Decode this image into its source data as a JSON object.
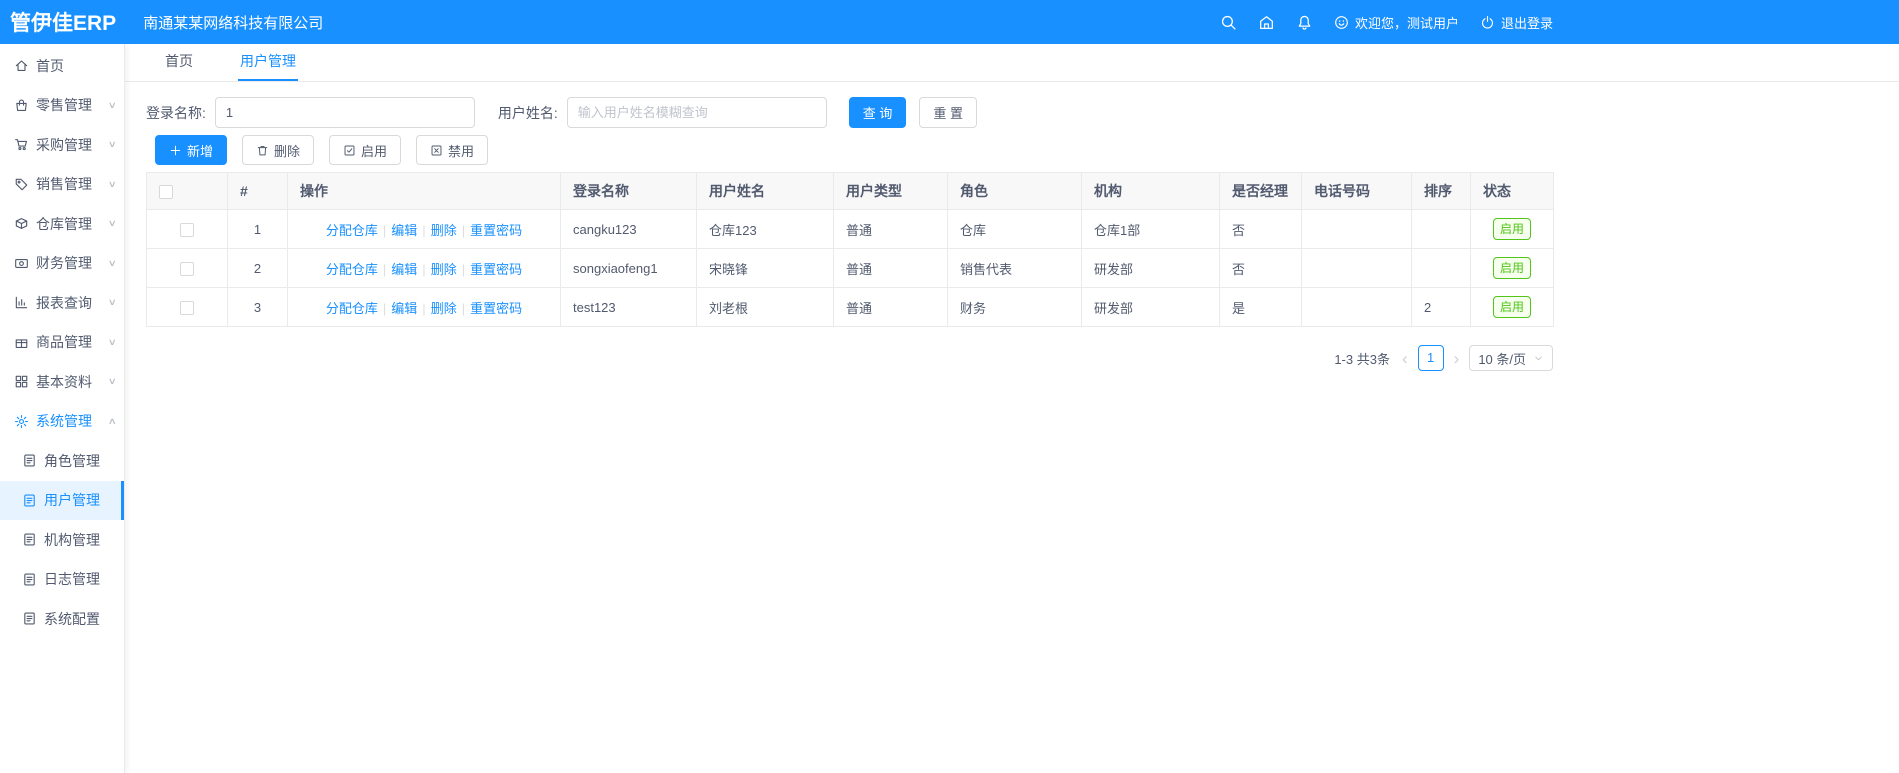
{
  "colors": {
    "primary": "#1890ff",
    "success": "#52c41a",
    "header_bg": "#1890ff",
    "active_menu_bg": "#e7f3fe"
  },
  "header": {
    "logo": "管伊佳ERP",
    "company": "南通某某网络科技有限公司",
    "welcome": "欢迎您，测试用户",
    "logout": "退出登录"
  },
  "icons": {
    "topbar": [
      "search-icon",
      "home-icon",
      "bell-icon",
      "smile-icon",
      "power-icon"
    ],
    "sidebar": [
      "home-icon",
      "retail-icon",
      "purchase-icon",
      "sales-icon",
      "warehouse-icon",
      "finance-icon",
      "report-icon",
      "goods-icon",
      "basic-data-icon",
      "gear-icon",
      "document-icon"
    ]
  },
  "sidebar": {
    "items": [
      {
        "label": "首页",
        "icon": "home-icon",
        "chevron": ""
      },
      {
        "label": "零售管理",
        "icon": "retail-icon",
        "chevron": "∨"
      },
      {
        "label": "采购管理",
        "icon": "purchase-icon",
        "chevron": "∨"
      },
      {
        "label": "销售管理",
        "icon": "sales-icon",
        "chevron": "∨"
      },
      {
        "label": "仓库管理",
        "icon": "warehouse-icon",
        "chevron": "∨"
      },
      {
        "label": "财务管理",
        "icon": "finance-icon",
        "chevron": "∨"
      },
      {
        "label": "报表查询",
        "icon": "report-icon",
        "chevron": "∨"
      },
      {
        "label": "商品管理",
        "icon": "goods-icon",
        "chevron": "∨"
      },
      {
        "label": "基本资料",
        "icon": "basic-data-icon",
        "chevron": "∨"
      },
      {
        "label": "系统管理",
        "icon": "gear-icon",
        "chevron": "∧"
      }
    ],
    "subitems": [
      {
        "label": "角色管理",
        "icon": "document-icon"
      },
      {
        "label": "用户管理",
        "icon": "document-icon"
      },
      {
        "label": "机构管理",
        "icon": "document-icon"
      },
      {
        "label": "日志管理",
        "icon": "document-icon"
      },
      {
        "label": "系统配置",
        "icon": "document-icon"
      }
    ]
  },
  "tabs": [
    {
      "label": "首页"
    },
    {
      "label": "用户管理"
    }
  ],
  "filters": {
    "login_label": "登录名称:",
    "login_value": "1",
    "name_label": "用户姓名:",
    "name_placeholder": "输入用户姓名模糊查询",
    "search_button": "查 询",
    "reset_button": "重 置"
  },
  "toolbar": {
    "add": "新增",
    "delete": "删除",
    "enable": "启用",
    "disable": "禁用"
  },
  "table": {
    "headers": [
      "#",
      "操作",
      "登录名称",
      "用户姓名",
      "用户类型",
      "角色",
      "机构",
      "是否经理",
      "电话号码",
      "排序",
      "状态"
    ],
    "op_links": [
      "分配仓库",
      "编辑",
      "删除",
      "重置密码"
    ],
    "rows": [
      {
        "index": "1",
        "login": "cangku123",
        "name": "仓库123",
        "type": "普通",
        "role": "仓库",
        "org": "仓库1部",
        "manager": "否",
        "phone": "",
        "sort": "",
        "status": "启用"
      },
      {
        "index": "2",
        "login": "songxiaofeng1",
        "name": "宋晓锋",
        "type": "普通",
        "role": "销售代表",
        "org": "研发部",
        "manager": "否",
        "phone": "",
        "sort": "",
        "status": "启用"
      },
      {
        "index": "3",
        "login": "test123",
        "name": "刘老根",
        "type": "普通",
        "role": "财务",
        "org": "研发部",
        "manager": "是",
        "phone": "",
        "sort": "2",
        "status": "启用"
      }
    ]
  },
  "pagination": {
    "total": "1-3 共3条",
    "prev": "‹",
    "page": "1",
    "next": "›",
    "page_size": "10 条/页"
  }
}
